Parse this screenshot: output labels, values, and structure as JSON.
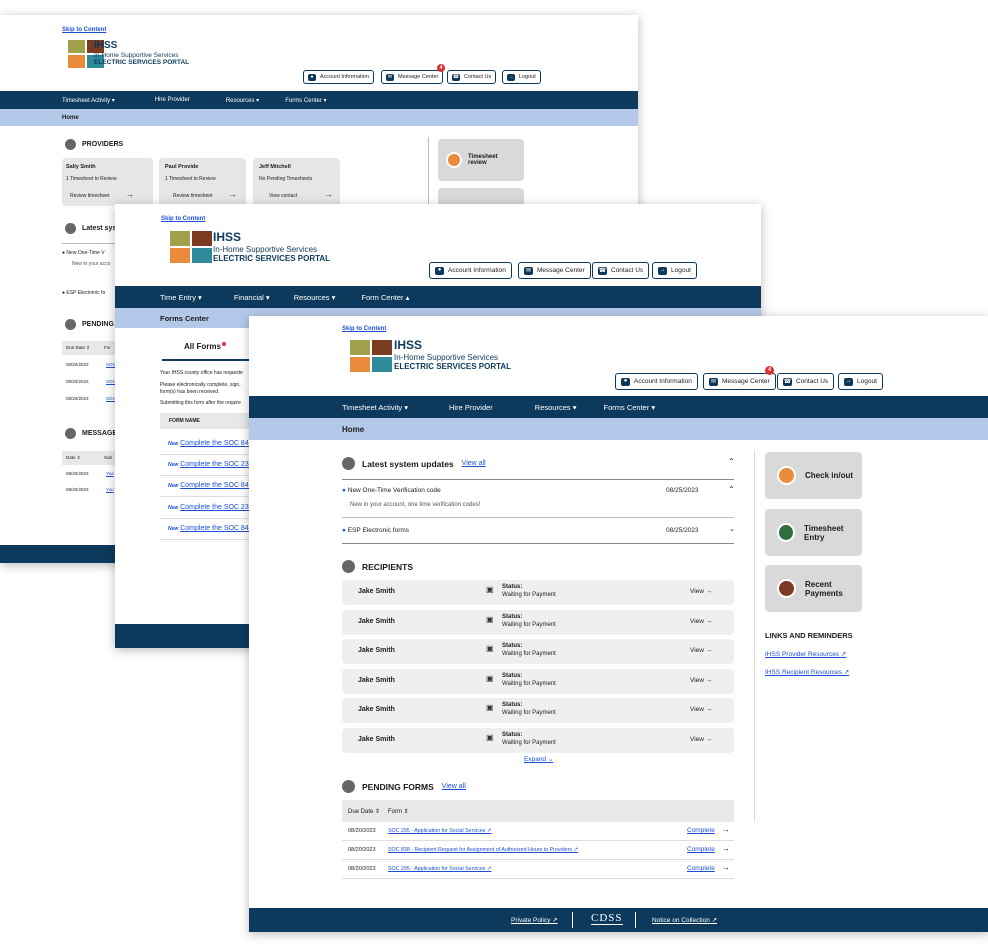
{
  "brand": {
    "skip": "Skip to Content",
    "name": "IHSS",
    "sub": "In-Home Supportive Services",
    "portal": "ELECTRIC SERVICES PORTAL",
    "colors": [
      "#a3a04c",
      "#7a3b22",
      "#e98b3a",
      "#2f8a99"
    ]
  },
  "header": {
    "account": "Account Information",
    "messages": "Message Center",
    "contact": "Contact Us",
    "logout": "Logout",
    "badge": "4"
  },
  "s1": {
    "nav": [
      "Timesheet Activity ▾",
      "Hire Provider",
      "Resources ▾",
      "Forms Center ▾"
    ],
    "crumb": "Home",
    "providers_title": "PROVIDERS",
    "providers": [
      {
        "name": "Sally Smith",
        "status": "1 Timesheet to Review",
        "action": "Review timesheet"
      },
      {
        "name": "Paul Provide",
        "status": "1 Timesheet to Review",
        "action": "Review timesheet"
      },
      {
        "name": "Jeff Mitchell",
        "status": "No Pending Timesheets",
        "action": "View contact"
      }
    ],
    "tile1": "Timesheet review",
    "latest_title": "Latest sys",
    "upd1": "New One-Time V",
    "upd1_sub": "New in your acco",
    "upd2": "ESP Electronic fo",
    "pending_title": "PENDING",
    "pending_head": [
      "Due Date ⇕",
      "For"
    ],
    "pending_dates": [
      "08/20/2023",
      "08/20/2023",
      "08/20/2023"
    ],
    "pending_forms": [
      "SOC",
      "SOC",
      "SOC"
    ],
    "message_title": "MESSAGE",
    "msg_head": [
      "Date ⇕",
      "Sub"
    ],
    "msg_dates": [
      "08/20/2023",
      "08/20/2023"
    ],
    "msg_subs": [
      "Yea",
      "You"
    ]
  },
  "s2": {
    "nav": [
      "Time Entry ▾",
      "Financial ▾",
      "Resources ▾",
      "Form Center ▴"
    ],
    "crumb": "Forms Center",
    "tab": "All Forms",
    "p1": "Your IHSS county office has requeste",
    "p2": "Please electronically complete, sign,",
    "p3": "form(s) has been received.",
    "p4": "Submitting this form after the require",
    "col": "FORM NAME",
    "new": "New",
    "forms": [
      "Complete the SOC 846",
      "Complete the SOC 2305",
      "Complete the SOC 846",
      "Complete the SOC 2305",
      "Complete the SOC 846"
    ]
  },
  "s3": {
    "nav": [
      "Timesheet Activity ▾",
      "Hire Provider",
      "Resources ▾",
      "Forms Center ▾"
    ],
    "crumb": "Home",
    "latest_title": "Latest system updates",
    "view_all": "View all",
    "updates": [
      {
        "title": "New One-Time Verification code",
        "date": "08/25/2023",
        "body": "New in your account, one time verification codes!"
      },
      {
        "title": "ESP Electronic forms",
        "date": "08/25/2023"
      }
    ],
    "recipients_title": "RECIPIENTS",
    "recipients": [
      {
        "name": "Jake Smith",
        "status_label": "Status:",
        "status": "Waiting for Payment",
        "action": "View"
      },
      {
        "name": "Jake Smith",
        "status_label": "Status:",
        "status": "Waiting for Payment",
        "action": "View"
      },
      {
        "name": "Jake Smith",
        "status_label": "Status:",
        "status": "Waiting for Payment",
        "action": "View"
      },
      {
        "name": "Jake Smith",
        "status_label": "Status:",
        "status": "Waiting for Payment",
        "action": "View"
      },
      {
        "name": "Jake Smith",
        "status_label": "Status:",
        "status": "Waiting for Payment",
        "action": "View"
      },
      {
        "name": "Jake Smith",
        "status_label": "Status:",
        "status": "Waiting for Payment",
        "action": "View"
      }
    ],
    "expand": "Expand",
    "pending_title": "PENDING FORMS",
    "pending_view_all": "View all",
    "pending_head": [
      "Due Date ⇕",
      "Form ⇕"
    ],
    "pending": [
      {
        "date": "08/20/2023",
        "form": "SOC 295 - Application for Social Services",
        "action": "Complete"
      },
      {
        "date": "08/20/2023",
        "form": "SOC 838 - Recipient Request for Assignment of Authorized Hours to Providers",
        "action": "Complete"
      },
      {
        "date": "08/20/2023",
        "form": "SOC 295 - Application for Social Services",
        "action": "Complete"
      }
    ],
    "tiles": [
      "Check in/out",
      "Timesheet Entry",
      "Recent Payments"
    ],
    "links_title": "LINKS AND REMINDERS",
    "links": [
      "IHSS Provider Resources",
      "IHSS Recipient Resources"
    ],
    "footer": {
      "privacy": "Private Policy",
      "cdss": "CDSS",
      "notice": "Notice on Collection"
    }
  }
}
